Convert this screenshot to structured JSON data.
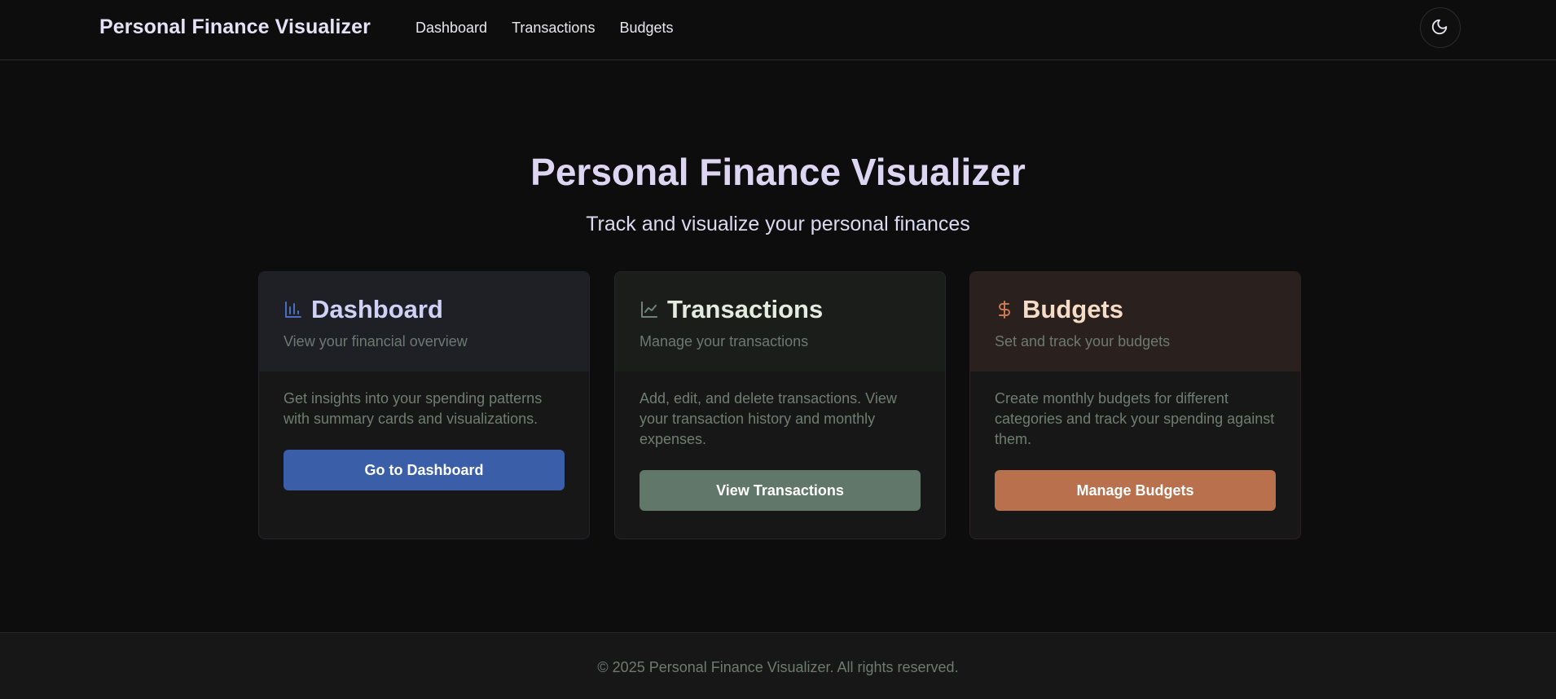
{
  "header": {
    "brand": "Personal Finance Visualizer",
    "nav": [
      {
        "label": "Dashboard"
      },
      {
        "label": "Transactions"
      },
      {
        "label": "Budgets"
      }
    ],
    "theme_toggle_icon": "moon-icon"
  },
  "hero": {
    "title": "Personal Finance Visualizer",
    "subtitle": "Track and visualize your personal finances"
  },
  "cards": [
    {
      "icon": "bar-chart-icon",
      "title": "Dashboard",
      "subtitle": "View your financial overview",
      "description": "Get insights into your spending patterns with summary cards and visualizations.",
      "button": "Go to Dashboard",
      "accent": "#3b5ea8"
    },
    {
      "icon": "line-chart-icon",
      "title": "Transactions",
      "subtitle": "Manage your transactions",
      "description": "Add, edit, and delete transactions. View your transaction history and monthly expenses.",
      "button": "View Transactions",
      "accent": "#60776a"
    },
    {
      "icon": "dollar-icon",
      "title": "Budgets",
      "subtitle": "Set and track your budgets",
      "description": "Create monthly budgets for different categories and track your spending against them.",
      "button": "Manage Budgets",
      "accent": "#b8704d"
    }
  ],
  "footer": {
    "text": "© 2025 Personal Finance Visualizer. All rights reserved."
  }
}
